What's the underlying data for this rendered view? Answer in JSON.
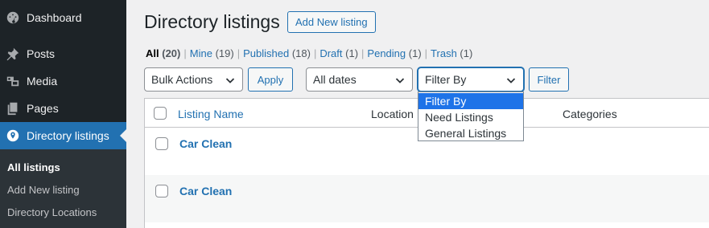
{
  "sidebar": {
    "items": [
      {
        "label": "Dashboard",
        "icon": "dashboard-icon"
      },
      {
        "label": "Posts",
        "icon": "pin-icon"
      },
      {
        "label": "Media",
        "icon": "media-icon"
      },
      {
        "label": "Pages",
        "icon": "pages-icon"
      },
      {
        "label": "Directory listings",
        "icon": "directory-icon"
      }
    ],
    "submenu": [
      {
        "label": "All listings"
      },
      {
        "label": "Add New listing"
      },
      {
        "label": "Directory Locations"
      }
    ]
  },
  "header": {
    "title": "Directory listings",
    "add_new_label": "Add New listing"
  },
  "views": [
    {
      "label": "All",
      "count": "(20)"
    },
    {
      "label": "Mine",
      "count": "(19)"
    },
    {
      "label": "Published",
      "count": "(18)"
    },
    {
      "label": "Draft",
      "count": "(1)"
    },
    {
      "label": "Pending",
      "count": "(1)"
    },
    {
      "label": "Trash",
      "count": "(1)"
    }
  ],
  "view_separator": "|",
  "filters": {
    "bulk_actions": "Bulk Actions",
    "apply_label": "Apply",
    "dates": "All dates",
    "filter_by": "Filter By",
    "filter_label": "Filter"
  },
  "dropdown": {
    "options": [
      "Filter By",
      "Need Listings",
      "General Listings"
    ],
    "selected": "Filter By"
  },
  "table": {
    "columns": [
      "Listing Name",
      "Location",
      "Categories"
    ],
    "rows": [
      {
        "title": "Car Clean"
      },
      {
        "title": "Car Clean"
      }
    ]
  },
  "colors": {
    "accent": "#2271b1",
    "sidebar_bg": "#1d2327",
    "selected_option": "#1e73e8"
  }
}
